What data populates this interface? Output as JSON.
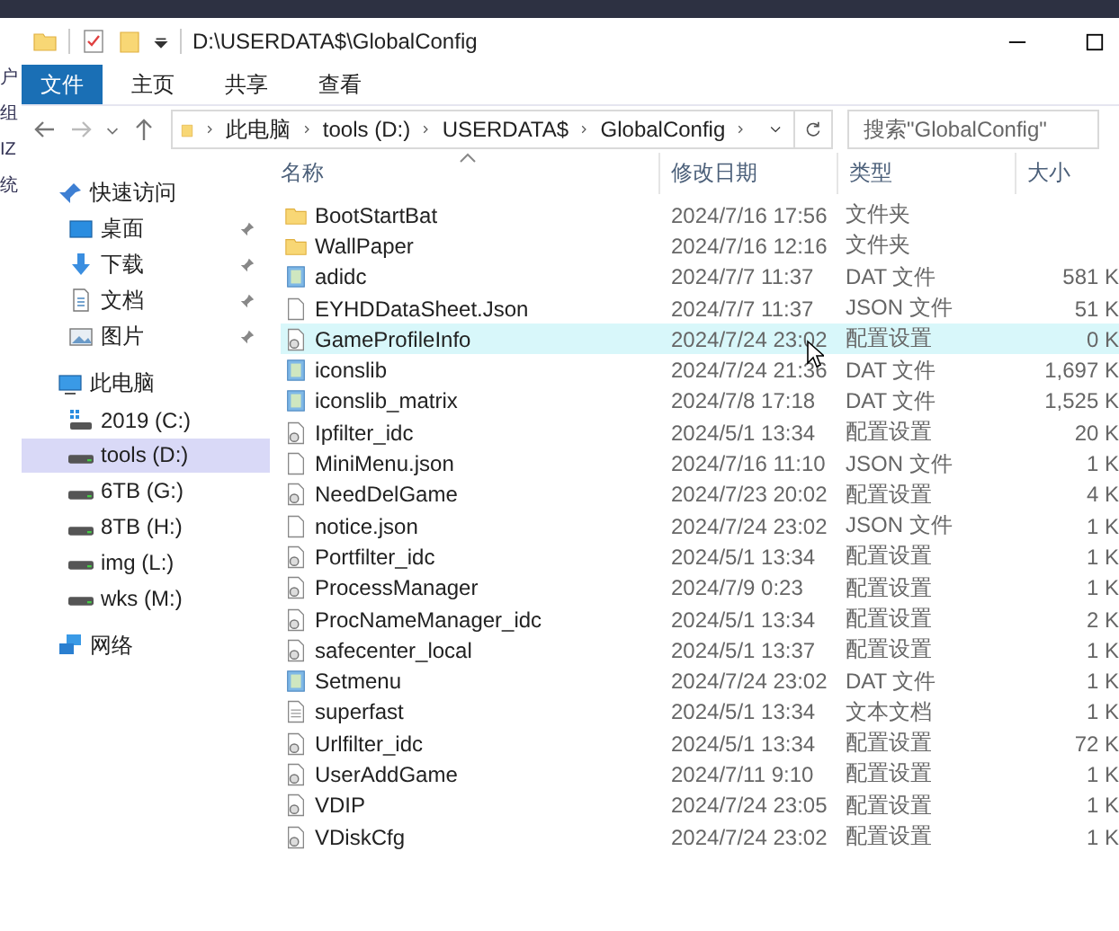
{
  "background_app": {
    "side_fragments": [
      "户",
      "组",
      "IZ",
      "统"
    ]
  },
  "window": {
    "title": "D:\\USERDATA$\\GlobalConfig"
  },
  "ribbon_tabs": [
    {
      "label": "文件",
      "selected": true
    },
    {
      "label": "主页",
      "selected": false
    },
    {
      "label": "共享",
      "selected": false
    },
    {
      "label": "查看",
      "selected": false
    }
  ],
  "address_bar": {
    "segments": [
      "此电脑",
      "tools (D:)",
      "USERDATA$",
      "GlobalConfig"
    ]
  },
  "search": {
    "placeholder": "搜索\"GlobalConfig\""
  },
  "sidebar": {
    "items": [
      {
        "label": "快速访问",
        "kind": "star",
        "selected": false,
        "children": [
          {
            "label": "桌面",
            "kind": "desktop",
            "pinned": true,
            "selected": false
          },
          {
            "label": "下载",
            "kind": "download",
            "pinned": true,
            "selected": false
          },
          {
            "label": "文档",
            "kind": "document",
            "pinned": true,
            "selected": false
          },
          {
            "label": "图片",
            "kind": "image",
            "pinned": true,
            "selected": false
          }
        ]
      },
      {
        "label": "此电脑",
        "kind": "computer",
        "selected": false,
        "children": [
          {
            "label": "2019 (C:)",
            "kind": "system-drive",
            "selected": false
          },
          {
            "label": "tools (D:)",
            "kind": "drive",
            "selected": true
          },
          {
            "label": "6TB (G:)",
            "kind": "drive",
            "selected": false
          },
          {
            "label": "8TB (H:)",
            "kind": "drive",
            "selected": false
          },
          {
            "label": "img (L:)",
            "kind": "drive",
            "selected": false
          },
          {
            "label": "wks (M:)",
            "kind": "drive",
            "selected": false
          }
        ]
      },
      {
        "label": "网络",
        "kind": "network",
        "selected": false
      }
    ]
  },
  "table": {
    "columns": [
      "名称",
      "修改日期",
      "类型",
      "大小"
    ],
    "rows": [
      {
        "name": "BootStartBat",
        "date": "2024/7/16 17:56",
        "type": "文件夹",
        "kind": "folder",
        "selected": false
      },
      {
        "name": "WallPaper",
        "date": "2024/7/16 12:16",
        "type": "文件夹",
        "kind": "folder",
        "selected": false
      },
      {
        "name": "adidc",
        "date": "2024/7/7 11:37",
        "type": "DAT 文件",
        "size": "581 K",
        "kind": "dat",
        "selected": false
      },
      {
        "name": "EYHDDataSheet.Json",
        "date": "2024/7/7 11:37",
        "type": "JSON 文件",
        "size": "51 K",
        "kind": "json",
        "selected": false
      },
      {
        "name": "GameProfileInfo",
        "date": "2024/7/24 23:02",
        "type": "配置设置",
        "size": "0 K",
        "kind": "config",
        "selected": true
      },
      {
        "name": "iconslib",
        "date": "2024/7/24 21:36",
        "type": "DAT 文件",
        "size": "1,697 K",
        "kind": "dat",
        "selected": false
      },
      {
        "name": "iconslib_matrix",
        "date": "2024/7/8 17:18",
        "type": "DAT 文件",
        "size": "1,525 K",
        "kind": "dat",
        "selected": false
      },
      {
        "name": "Ipfilter_idc",
        "date": "2024/5/1 13:34",
        "type": "配置设置",
        "size": "20 K",
        "kind": "config",
        "selected": false
      },
      {
        "name": "MiniMenu.json",
        "date": "2024/7/16 11:10",
        "type": "JSON 文件",
        "size": "1 K",
        "kind": "json",
        "selected": false
      },
      {
        "name": "NeedDelGame",
        "date": "2024/7/23 20:02",
        "type": "配置设置",
        "size": "4 K",
        "kind": "config",
        "selected": false
      },
      {
        "name": "notice.json",
        "date": "2024/7/24 23:02",
        "type": "JSON 文件",
        "size": "1 K",
        "kind": "json",
        "selected": false
      },
      {
        "name": "Portfilter_idc",
        "date": "2024/5/1 13:34",
        "type": "配置设置",
        "size": "1 K",
        "kind": "config",
        "selected": false
      },
      {
        "name": "ProcessManager",
        "date": "2024/7/9 0:23",
        "type": "配置设置",
        "size": "1 K",
        "kind": "config",
        "selected": false
      },
      {
        "name": "ProcNameManager_idc",
        "date": "2024/5/1 13:34",
        "type": "配置设置",
        "size": "2 K",
        "kind": "config",
        "selected": false
      },
      {
        "name": "safecenter_local",
        "date": "2024/5/1 13:37",
        "type": "配置设置",
        "size": "1 K",
        "kind": "config",
        "selected": false
      },
      {
        "name": "Setmenu",
        "date": "2024/7/24 23:02",
        "type": "DAT 文件",
        "size": "1 K",
        "kind": "dat",
        "selected": false
      },
      {
        "name": "superfast",
        "date": "2024/5/1 13:34",
        "type": "文本文档",
        "size": "1 K",
        "kind": "text",
        "selected": false
      },
      {
        "name": "Urlfilter_idc",
        "date": "2024/5/1 13:34",
        "type": "配置设置",
        "size": "72 K",
        "kind": "config",
        "selected": false
      },
      {
        "name": "UserAddGame",
        "date": "2024/7/11 9:10",
        "type": "配置设置",
        "size": "1 K",
        "kind": "config",
        "selected": false
      },
      {
        "name": "VDIP",
        "date": "2024/7/24 23:05",
        "type": "配置设置",
        "size": "1 K",
        "kind": "config",
        "selected": false
      },
      {
        "name": "VDiskCfg",
        "date": "2024/7/24 23:02",
        "type": "配置设置",
        "size": "1 K",
        "kind": "config",
        "selected": false
      }
    ]
  }
}
